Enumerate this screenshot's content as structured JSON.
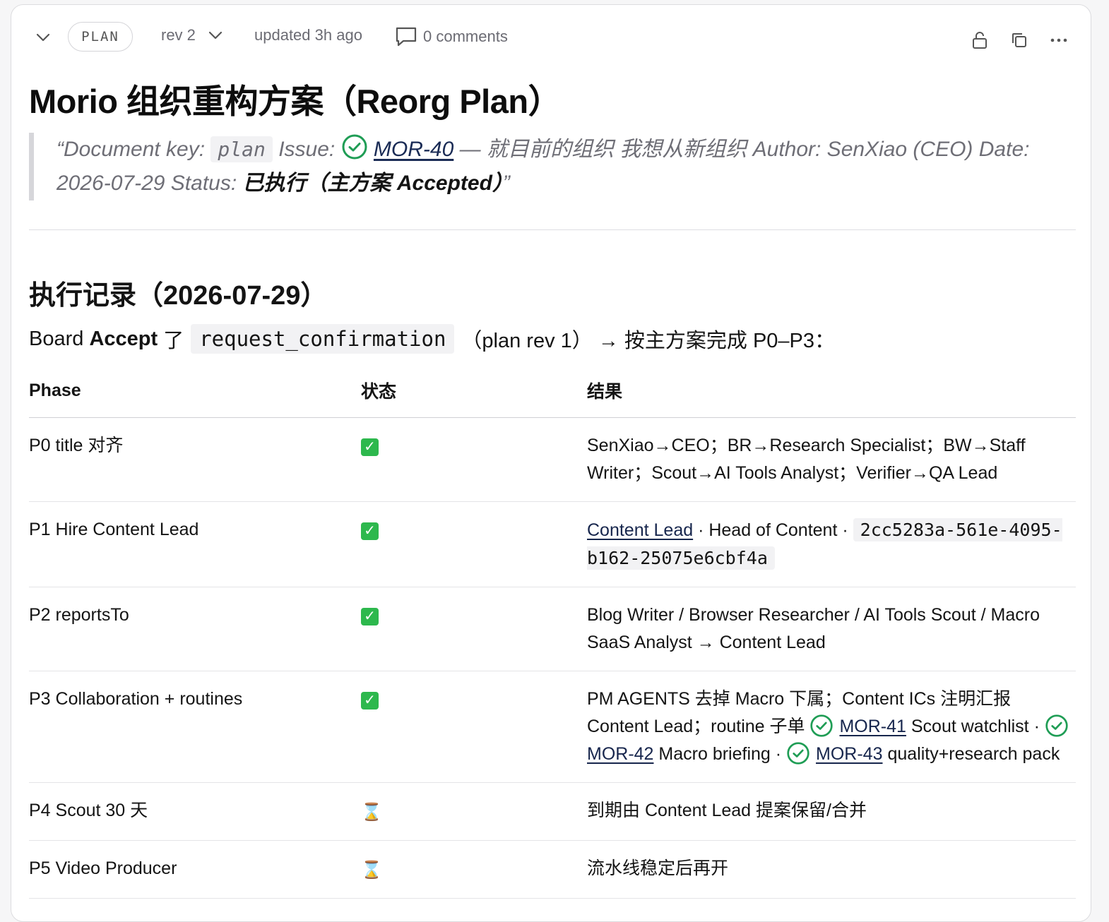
{
  "header": {
    "badge": "PLAN",
    "revision": "rev 2",
    "updated": "updated 3h ago",
    "comments": "0 comments"
  },
  "document": {
    "title": "Morio 组织重构方案（Reorg Plan）",
    "quote": {
      "open": "“Document key: ",
      "key": "plan",
      "issue_label": " Issue: ",
      "issue_link": "MOR-40",
      "line_rest": " — 就目前的组织 我想从新组织 Author: SenXiao (CEO) Date:",
      "line2_start": "2026-07-29 Status: ",
      "status_value": "已执行（主方案 Accepted）",
      "close": "”"
    }
  },
  "section": {
    "heading": "执行记录（2026-07-29）",
    "intro_prefix": "Board ",
    "intro_bold": "Accept",
    "intro_mid": " 了",
    "intro_code": "request_confirmation",
    "intro_suffix": "（plan rev 1） → 按主方案完成 P0–P3："
  },
  "table": {
    "headers": [
      "Phase",
      "状态",
      "结果"
    ],
    "rows": [
      {
        "phase": "P0 title 对齐",
        "status": "done",
        "result": "SenXiao→CEO；BR→Research Specialist；BW→Staff Writer；Scout→AI Tools Analyst；Verifier→QA Lead"
      },
      {
        "phase": "P1 Hire Content Lead",
        "status": "done",
        "result_link": "Content Lead",
        "result_text": " · Head of Content · ",
        "result_code": "2cc5283a-561e-4095-b162-25075e6cbf4a"
      },
      {
        "phase": "P2 reportsTo",
        "status": "done",
        "result": "Blog Writer / Browser Researcher / AI Tools Scout / Macro SaaS Analyst → Content Lead"
      },
      {
        "phase": "P3 Collaboration + routines",
        "status": "done",
        "result_a": "PM AGENTS 去掉 Macro 下属；Content ICs 注明汇报 Content Lead；routine 子单 ",
        "link1": "MOR-41",
        "text1": " Scout watchlist · ",
        "link2": "MOR-42",
        "text2": " Macro briefing · ",
        "link3": "MOR-43",
        "text3": " quality+research pack"
      },
      {
        "phase": "P4 Scout 30 天",
        "status": "pending",
        "result": "到期由 Content Lead 提案保留/合并"
      },
      {
        "phase": "P5 Video Producer",
        "status": "pending",
        "result": "流水线稳定后再开"
      }
    ]
  },
  "colors": {
    "check_green": "#2db84d",
    "issue_green": "#1f9d55",
    "link": "#17264d"
  },
  "icons": [
    "chevron-down-icon",
    "comment-icon",
    "unlock-icon",
    "copy-icon",
    "more-icon",
    "issue-done-icon",
    "check-mark-icon",
    "hourglass-icon"
  ]
}
